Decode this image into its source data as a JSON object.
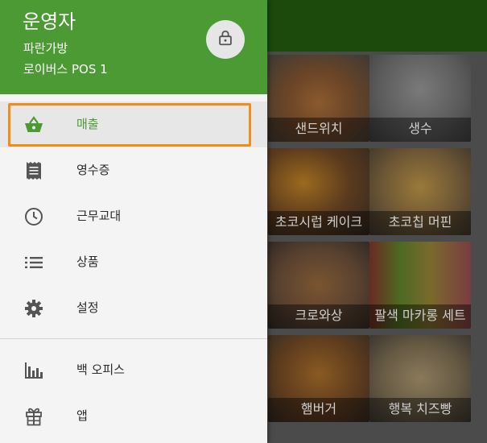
{
  "drawer": {
    "merchant_name": "운영자",
    "store_name": "파란가방",
    "pos_name": "로이버스 POS 1",
    "lock_icon": "lock-icon",
    "accent_color": "#4b9a34",
    "highlight_color": "#f28c1a",
    "items": [
      {
        "label": "매출",
        "icon": "basket-icon",
        "active": true
      },
      {
        "label": "영수증",
        "icon": "receipt-icon"
      },
      {
        "label": "근무교대",
        "icon": "clock-icon"
      },
      {
        "label": "상품",
        "icon": "list-icon"
      },
      {
        "label": "설정",
        "icon": "gear-icon"
      },
      {
        "label": "백 오피스",
        "icon": "bar-chart-icon"
      },
      {
        "label": "앱",
        "icon": "gift-icon"
      }
    ]
  },
  "products": [
    {
      "name": "샌드위치"
    },
    {
      "name": "생수"
    },
    {
      "name": "초코시럽 케이크"
    },
    {
      "name": "초코칩 머핀"
    },
    {
      "name": "크로와상"
    },
    {
      "name": "팔색 마카롱 세트"
    },
    {
      "name": "햄버거"
    },
    {
      "name": "행복 치즈빵"
    }
  ]
}
